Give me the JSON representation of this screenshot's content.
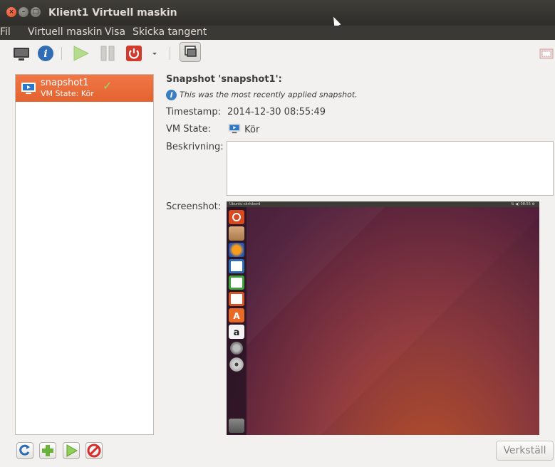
{
  "window": {
    "title": "Klient1 Virtuell maskin"
  },
  "menubar": {
    "items": [
      "Fil",
      "Virtuell maskin",
      "Visa",
      "Skicka tangent"
    ]
  },
  "toolbar": {
    "items": [
      "monitor-icon",
      "info-icon",
      "play-icon",
      "pause-icon",
      "power-icon",
      "dropdown-arrow-icon",
      "snapshot-manager-icon",
      "fullscreen-icon"
    ]
  },
  "snapshots": [
    {
      "name": "snapshot1",
      "state": "VM State: Kör",
      "current": true
    }
  ],
  "details": {
    "title": "Snapshot 'snapshot1':",
    "info": "This was the most recently applied snapshot.",
    "timestamp_label": "Timestamp:",
    "timestamp": "2014-12-30 08:55:49",
    "vmstate_label": "VM State:",
    "vmstate": "Kör",
    "description_label": "Beskrivning:",
    "description": "",
    "screenshot_label": "Screenshot:"
  },
  "screenshot_preview": {
    "topbar_label": "Ubuntu-skrivbord",
    "topbar_right": "⇅ ◀) 08:55 ⚙",
    "launcher_icons": [
      "ubuntu-dash-icon",
      "files-icon",
      "firefox-icon",
      "writer-icon",
      "calc-icon",
      "impress-icon",
      "software-center-icon",
      "amazon-icon",
      "settings-icon",
      "dvd-icon",
      "trash-icon"
    ]
  },
  "bottom_buttons": [
    "refresh-icon",
    "add-icon",
    "restore-icon",
    "delete-icon"
  ],
  "apply_label": "Verkställ",
  "colors": {
    "accent": "#e4632f",
    "titlebar": "#3c3b37",
    "close": "#df4a16"
  }
}
